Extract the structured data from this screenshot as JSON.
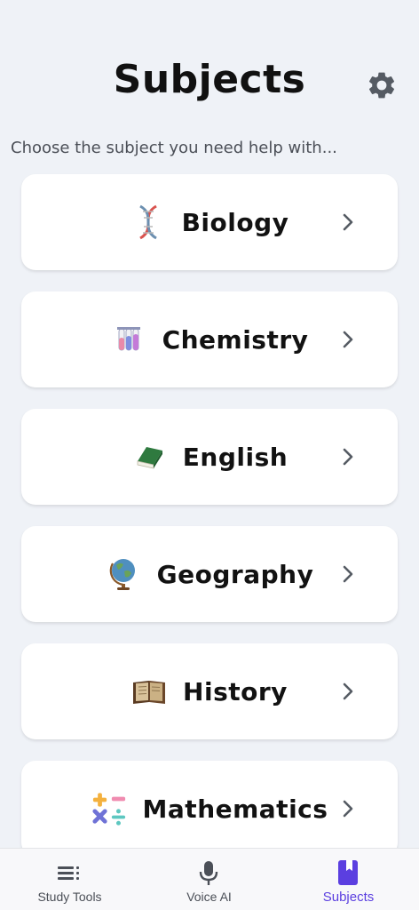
{
  "header": {
    "title": "Subjects",
    "subtitle": "Choose the subject you need help with..."
  },
  "subjects": [
    {
      "label": "Biology",
      "icon": "dna-icon"
    },
    {
      "label": "Chemistry",
      "icon": "test-tubes-icon"
    },
    {
      "label": "English",
      "icon": "green-book-icon"
    },
    {
      "label": "Geography",
      "icon": "globe-icon"
    },
    {
      "label": "History",
      "icon": "old-book-icon"
    },
    {
      "label": "Mathematics",
      "icon": "math-symbols-icon"
    }
  ],
  "nav": {
    "items": [
      {
        "label": "Study Tools",
        "icon": "list-icon"
      },
      {
        "label": "Voice AI",
        "icon": "microphone-icon"
      },
      {
        "label": "Subjects",
        "icon": "bookmark-book-icon"
      }
    ],
    "active": "Subjects"
  },
  "colors": {
    "background": "#eff2f7",
    "accent": "#5b3fe0",
    "card": "#ffffff",
    "text": "#121212"
  }
}
